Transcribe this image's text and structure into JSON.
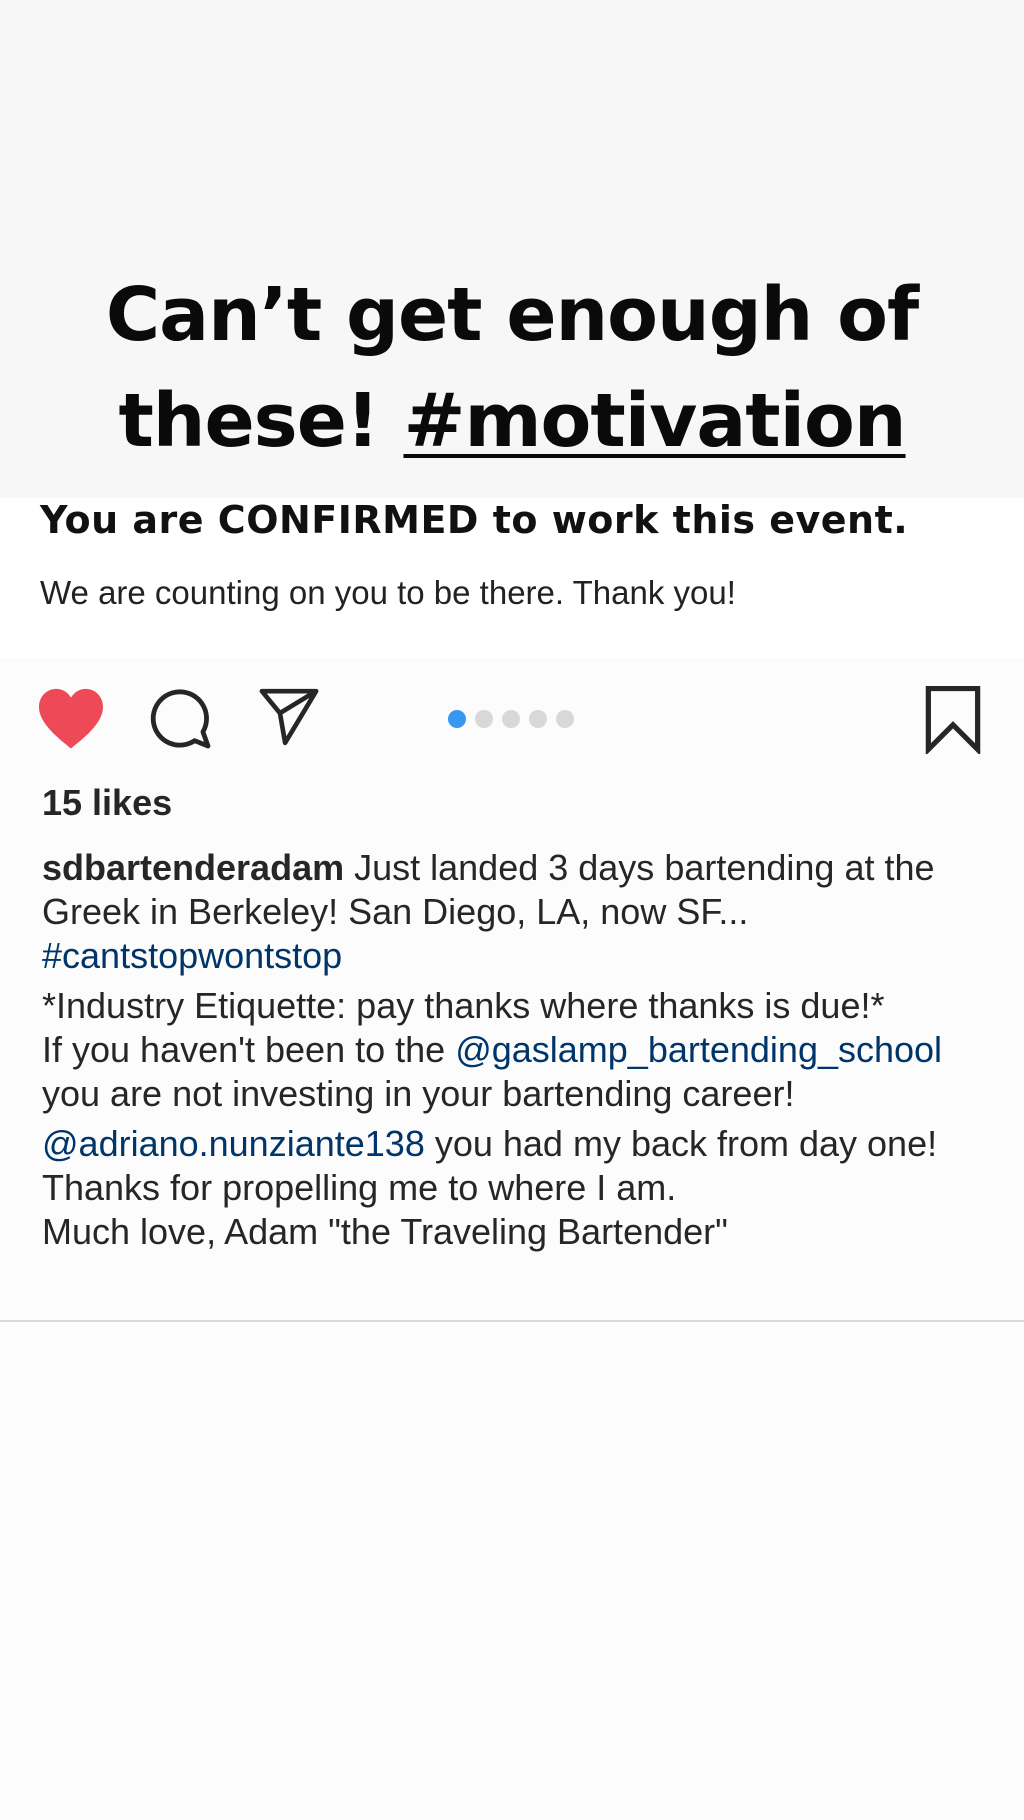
{
  "story": {
    "caption_line1": "Can’t get enough of",
    "caption_line2_text": "these! ",
    "caption_hashtag": "#motivation"
  },
  "post_image": {
    "title": "You are CONFIRMED to work this event.",
    "subtitle": "We are counting on you to be there. Thank you!"
  },
  "actions": {
    "heart_icon": "heart-filled",
    "comment_icon": "comment-bubble",
    "share_icon": "paper-plane",
    "bookmark_icon": "bookmark-outline",
    "carousel_total": 5,
    "carousel_active": 1,
    "accent_color": "#3897f0",
    "heart_color": "#ed4956"
  },
  "likes": "15 likes",
  "caption": {
    "username": "sdbartenderadam",
    "text1": " Just landed 3 days bartending at the Greek in Berkeley! San Diego, LA, now SF...",
    "hashtag1": "#cantstopwontstop",
    "line2": "*Industry Etiquette: pay thanks where thanks is due!*",
    "line3_prefix": "If you haven't been to the ",
    "mention1": "@gaslamp_bartending_school",
    "line3_suffix": " you are not investing in your bartending career!",
    "mention2": "@adriano.nunziante138",
    "line4_suffix": " you had my back from day one! Thanks for propelling me to where I am.",
    "line5": "Much love, Adam \"the Traveling Bartender\""
  }
}
